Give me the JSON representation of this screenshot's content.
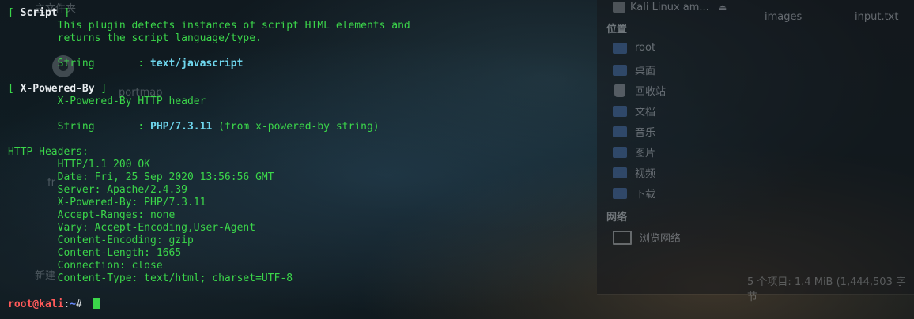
{
  "desktop": {
    "labels": {
      "folder_top": "主文件夹",
      "portmap": "portmap",
      "fr": "fr",
      "new": "新建"
    }
  },
  "file_manager": {
    "current_item": "Kali Linux am...",
    "columns": [
      "images",
      "input.txt"
    ],
    "places_header": "位置",
    "places": [
      {
        "label": "root",
        "icon": "folder-icon"
      },
      {
        "label": "桌面",
        "icon": "desktop-folder-icon"
      },
      {
        "label": "回收站",
        "icon": "trash-icon"
      },
      {
        "label": "文档",
        "icon": "documents-folder-icon"
      },
      {
        "label": "音乐",
        "icon": "music-folder-icon"
      },
      {
        "label": "图片",
        "icon": "pictures-folder-icon"
      },
      {
        "label": "视频",
        "icon": "videos-folder-icon"
      },
      {
        "label": "下载",
        "icon": "downloads-folder-icon"
      }
    ],
    "network_header": "网络",
    "network_items": [
      {
        "label": "浏览网络",
        "icon": "network-icon"
      }
    ],
    "status": "5 个项目: 1.4 MiB (1,444,503 字节"
  },
  "terminal": {
    "script": {
      "open": "[ ",
      "title": "Script",
      "close": " ]",
      "desc1": "        This plugin detects instances of script HTML elements and",
      "desc2": "        returns the script language/type.",
      "string_label": "        String       : ",
      "string_value": "text/javascript"
    },
    "xpb": {
      "open": "[ ",
      "title": "X-Powered-By",
      "close": " ]",
      "desc": "        X-Powered-By HTTP header",
      "string_label": "        String       : ",
      "string_value": "PHP/7.3.11",
      "string_suffix": " (from x-powered-by string)"
    },
    "headers_title": "HTTP Headers:",
    "headers": [
      "        HTTP/1.1 200 OK",
      "        Date: Fri, 25 Sep 2020 13:56:56 GMT",
      "        Server: Apache/2.4.39",
      "        X-Powered-By: PHP/7.3.11",
      "        Accept-Ranges: none",
      "        Vary: Accept-Encoding,User-Agent",
      "        Content-Encoding: gzip",
      "        Content-Length: 1665",
      "        Connection: close",
      "        Content-Type: text/html; charset=UTF-8"
    ],
    "prompt": {
      "user_host": "root@kali",
      "sep": ":",
      "path": "~",
      "symbol": "# "
    }
  },
  "colors": {
    "terminal_text": "#3bd64a",
    "highlight_white": "#e8ecef",
    "value_cyan": "#6fd7ee",
    "prompt_red": "#ff5a5a",
    "path_blue": "#6a8cff"
  }
}
